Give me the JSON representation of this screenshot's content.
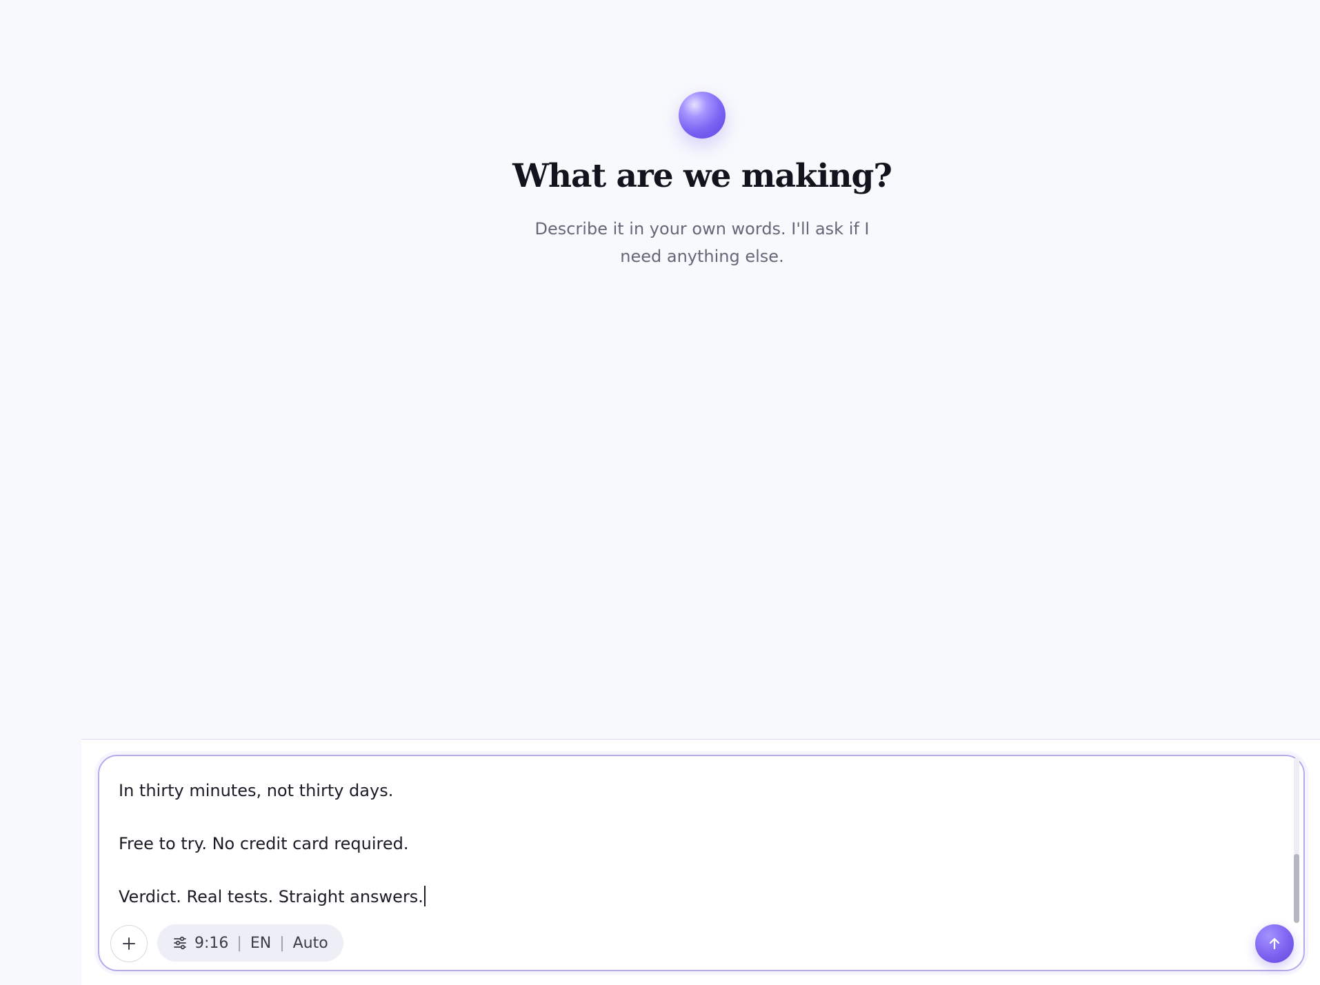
{
  "hero": {
    "title": "What are we making?",
    "subtitle": "Describe it in your own words. I'll ask if I need anything else."
  },
  "composer": {
    "lines": [
      "In thirty minutes, not thirty days.",
      "Free to try. No credit card required.",
      "Verdict. Real tests. Straight answers."
    ],
    "settings": {
      "aspect_ratio": "9:16",
      "language": "EN",
      "mode": "Auto",
      "separator": "|"
    },
    "icons": {
      "add": "plus-icon",
      "settings": "sliders-icon",
      "send": "arrow-up-icon"
    }
  },
  "colors": {
    "accent": "#7b63f3",
    "background": "#f8f9fd",
    "border": "#b8a9ee"
  }
}
